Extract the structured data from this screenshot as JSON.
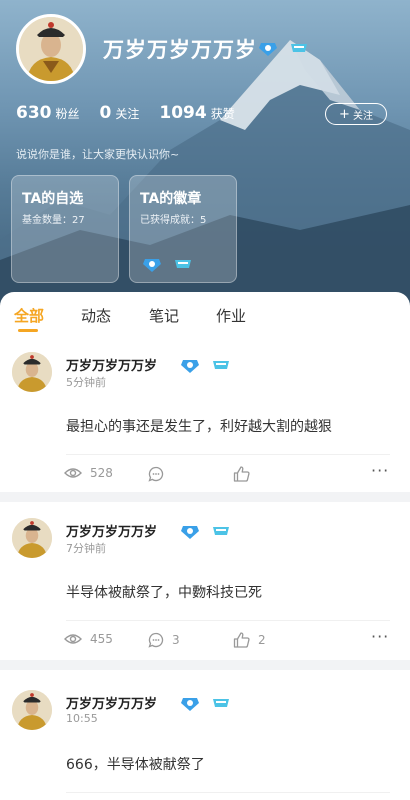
{
  "profile": {
    "nickname": "万岁万岁万万岁",
    "badges": [
      "badge-blue-icon",
      "badge-teal-icon"
    ],
    "fans_count": "630",
    "fans_label": "粉丝",
    "following_count": "0",
    "following_label": "关注",
    "likes_count": "1094",
    "likes_label": "获赞",
    "follow_button": "关注",
    "bio": "说说你是谁，让大家更快认识你~"
  },
  "cards": [
    {
      "title": "TA的自选",
      "subtitle": "基金数量：27"
    },
    {
      "title": "TA的徽章",
      "subtitle": "已获得成就：5"
    }
  ],
  "tabs": [
    {
      "label": "全部",
      "active": true
    },
    {
      "label": "动态",
      "active": false
    },
    {
      "label": "笔记",
      "active": false
    },
    {
      "label": "作业",
      "active": false
    }
  ],
  "posts": [
    {
      "author": "万岁万岁万万岁",
      "time": "5分钟前",
      "text": "最担心的事还是发生了，利好越大割的越狠",
      "views": "528",
      "comments": "",
      "likes": ""
    },
    {
      "author": "万岁万岁万万岁",
      "time": "7分钟前",
      "text": "半导体被献祭了，中覅科技已死",
      "views": "455",
      "comments": "3",
      "likes": "2"
    },
    {
      "author": "万岁万岁万万岁",
      "time": "10:55",
      "text": "666，半导体被献祭了",
      "views": "",
      "comments": "",
      "likes": ""
    }
  ],
  "colors": {
    "accent": "#f5a623",
    "badge_blue": "#3aa0e8",
    "badge_teal": "#4cc3e6"
  }
}
